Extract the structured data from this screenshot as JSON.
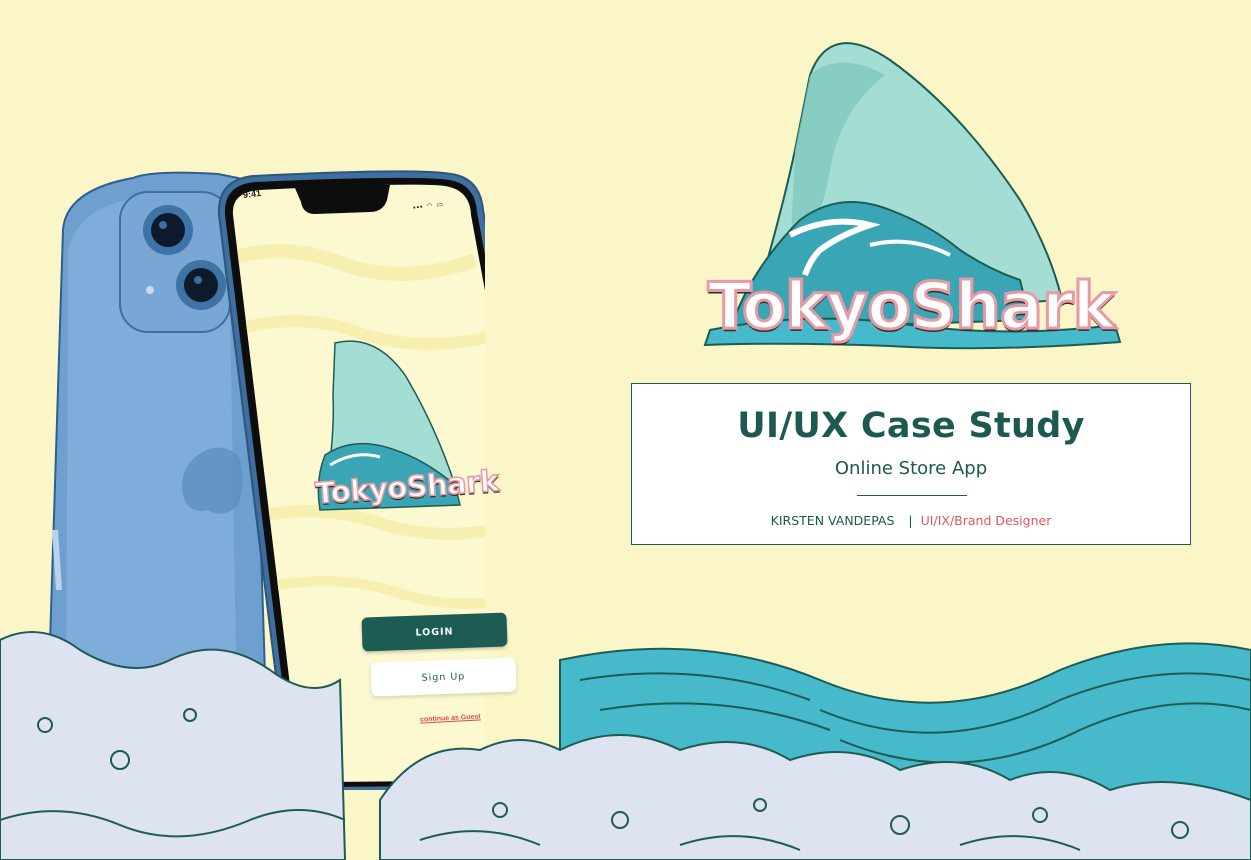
{
  "brand": {
    "name": "TokyoShark"
  },
  "case_study": {
    "title": "UI/UX Case Study",
    "subtitle": "Online Store App",
    "author": "KIRSTEN VANDEPAS",
    "separator": "|",
    "role": "UI/IX/Brand Designer"
  },
  "phone": {
    "status_time": "9:41",
    "status_icons": "▪▪▪ ◠ ▭",
    "app_name": "TokyoShark",
    "login_label": "LOGIN",
    "signup_label": "Sign Up",
    "guest_label": "continue as Guest"
  },
  "colors": {
    "background": "#fbf6c8",
    "primary": "#1d5c53",
    "accent": "#e0565e",
    "fin": "#8fd1c7",
    "wave": "#46b9cb",
    "foam": "#dde3f1"
  }
}
